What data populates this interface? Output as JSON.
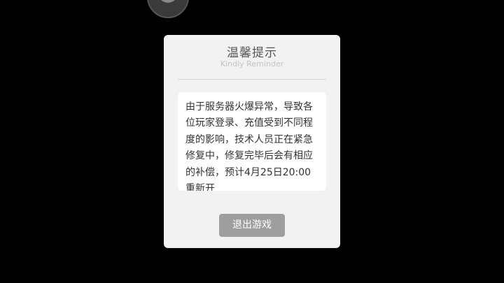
{
  "dialog": {
    "title": "温馨提示",
    "subtitle": "Kindly Reminder",
    "message": "由于服务器火爆异常，导致各位玩家登录、充值受到不同程度的影响，技术人员正在紧急修复中，修复完毕后会有相应的补偿，预计4月25日20:00重新开",
    "exit_button_label": "退出游戏"
  },
  "colors": {
    "background": "#000000",
    "dialog_bg": "#f2f2f2",
    "card_bg": "#ffffff",
    "button_bg": "#9e9e9e"
  }
}
